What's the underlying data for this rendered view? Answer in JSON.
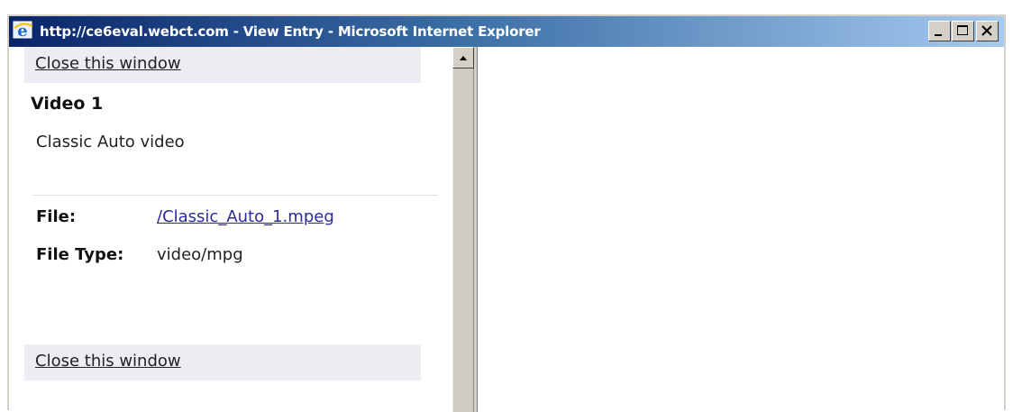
{
  "window": {
    "title": "http://ce6eval.webct.com - View Entry - Microsoft Internet Explorer",
    "controls": [
      "minimize",
      "maximize",
      "close"
    ],
    "titlebar_color": "#0a246a"
  },
  "entry": {
    "close_label": "Close this window",
    "title": "Video 1",
    "description": "Classic Auto video",
    "file_label": "File:",
    "file_value": "/Classic_Auto_1.mpeg",
    "file_type_label": "File Type:",
    "file_type_value": "video/mpg"
  },
  "icons": {
    "app": "internet-explorer-icon",
    "scroll_up": "arrow-up-icon"
  }
}
